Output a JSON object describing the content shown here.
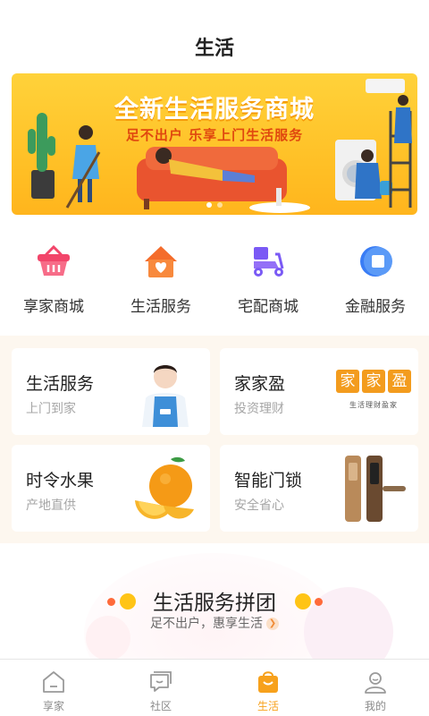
{
  "header": {
    "title": "生活"
  },
  "banner": {
    "title": "全新生活服务商城",
    "subtitle": "足不出户 乐享上门生活服务",
    "page_index": 1,
    "page_count": 2
  },
  "quick_menu": [
    {
      "label": "享家商城",
      "icon": "shopping-basket-icon",
      "color": "#f2456a"
    },
    {
      "label": "生活服务",
      "icon": "home-heart-icon",
      "color": "#f46c2b"
    },
    {
      "label": "宅配商城",
      "icon": "delivery-scooter-icon",
      "color": "#7a5af5"
    },
    {
      "label": "金融服务",
      "icon": "finance-square-icon",
      "color": "#3a7df5"
    }
  ],
  "cards": [
    {
      "title": "生活服务",
      "subtitle": "上门到家",
      "image": "service-staff-photo"
    },
    {
      "title": "家家盈",
      "subtitle": "投资理财",
      "image": "jiajiaying-logo",
      "logo_chars": [
        "家",
        "家",
        "盈"
      ],
      "logo_caption": "生活理财盈家"
    },
    {
      "title": "时令水果",
      "subtitle": "产地直供",
      "image": "orange-fruit-photo"
    },
    {
      "title": "智能门锁",
      "subtitle": "安全省心",
      "image": "smart-door-lock-photo"
    }
  ],
  "group_buy": {
    "title": "生活服务拼团",
    "subtitle": "足不出户，惠享生活"
  },
  "tabbar": [
    {
      "label": "享家",
      "icon": "home-tab-icon",
      "active": false
    },
    {
      "label": "社区",
      "icon": "community-chat-icon",
      "active": false
    },
    {
      "label": "生活",
      "icon": "shopping-bag-icon",
      "active": true
    },
    {
      "label": "我的",
      "icon": "profile-icon",
      "active": false
    }
  ],
  "colors": {
    "accent": "#f7a11c",
    "banner": "#ffc227",
    "section_bg": "#fdf7ef"
  }
}
